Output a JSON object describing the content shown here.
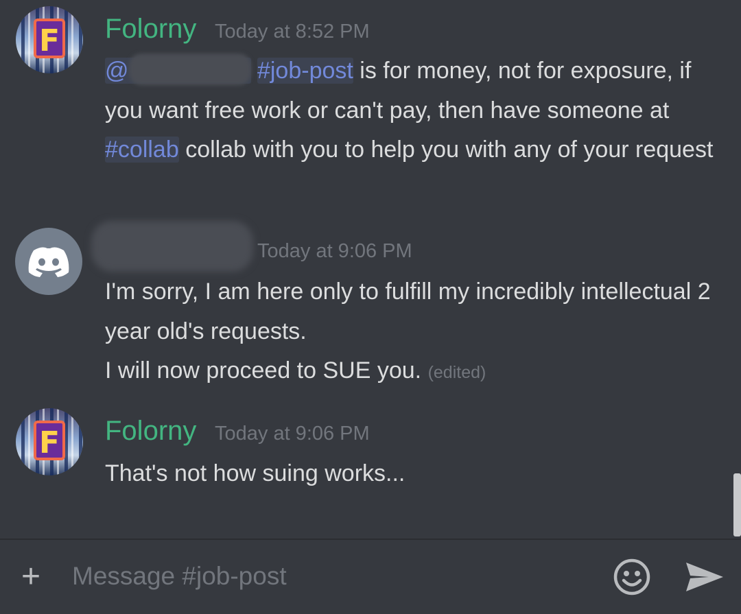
{
  "messages": [
    {
      "author": "Folorny",
      "timestamp": "Today at 8:52 PM",
      "mention_prefix": "@",
      "channel_1": "#job-post",
      "text_1": " is for money, not for exposure, if you want free work or can't pay, then have someone at ",
      "channel_2": "#collab",
      "text_2": " collab with you to help you with any of your request",
      "avatar_icon": "folorny-avatar"
    },
    {
      "timestamp": "Today at 9:06 PM",
      "line_1": "I'm sorry, I am here only to fulfill my incredibly intellectual 2 year old's requests.",
      "line_2": "I will now proceed to SUE you.",
      "edited": "(edited)",
      "avatar_icon": "discord-avatar"
    },
    {
      "author": "Folorny",
      "timestamp": "Today at 9:06 PM",
      "text": "That's not how suing works...",
      "avatar_icon": "folorny-avatar"
    }
  ],
  "composer": {
    "plus_label": "+",
    "placeholder": "Message #job-post",
    "emoji_icon": "emoji-icon",
    "send_icon": "send-icon"
  },
  "colors": {
    "background": "#36393f",
    "username": "#43b581",
    "mention": "#7289da",
    "timestamp": "#72767d",
    "text": "#dcddde"
  }
}
